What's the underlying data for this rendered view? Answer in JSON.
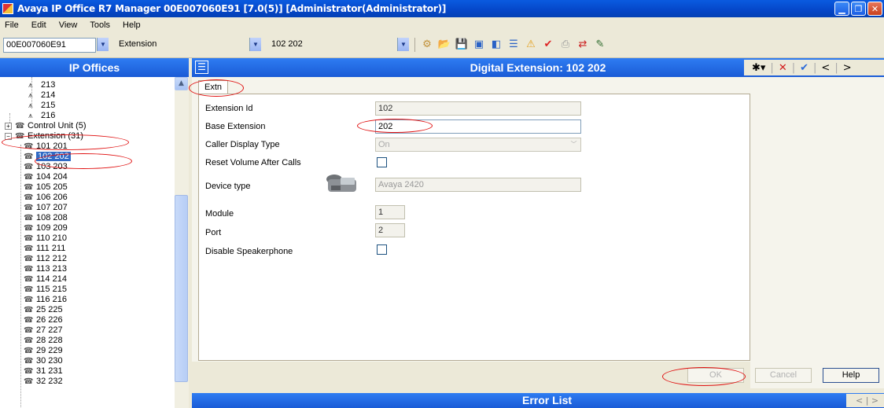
{
  "window": {
    "title": "Avaya IP Office R7 Manager 00E007060E91 [7.0(5)] [Administrator(Administrator)]"
  },
  "menu": [
    "File",
    "Edit",
    "View",
    "Tools",
    "Help"
  ],
  "toolbar": {
    "system_combo": "00E007060E91",
    "type_combo": "Extension",
    "item_combo": "102 202"
  },
  "left_panel": {
    "title": "IP Offices",
    "tree": [
      {
        "label": "213",
        "kind": "short"
      },
      {
        "label": "214",
        "kind": "short"
      },
      {
        "label": "215",
        "kind": "short"
      },
      {
        "label": "216",
        "kind": "short"
      },
      {
        "label": "Control Unit (5)",
        "kind": "group"
      },
      {
        "label": "Extension (31)",
        "kind": "group-open"
      },
      {
        "label": "101 201",
        "kind": "ext"
      },
      {
        "label": "102 202",
        "kind": "ext",
        "selected": true
      },
      {
        "label": "103 203",
        "kind": "ext"
      },
      {
        "label": "104 204",
        "kind": "ext"
      },
      {
        "label": "105 205",
        "kind": "ext"
      },
      {
        "label": "106 206",
        "kind": "ext"
      },
      {
        "label": "107 207",
        "kind": "ext"
      },
      {
        "label": "108 208",
        "kind": "ext"
      },
      {
        "label": "109 209",
        "kind": "ext"
      },
      {
        "label": "110 210",
        "kind": "ext"
      },
      {
        "label": "111 211",
        "kind": "ext"
      },
      {
        "label": "112 212",
        "kind": "ext"
      },
      {
        "label": "113 213",
        "kind": "ext"
      },
      {
        "label": "114 214",
        "kind": "ext"
      },
      {
        "label": "115 215",
        "kind": "ext"
      },
      {
        "label": "116 216",
        "kind": "ext"
      },
      {
        "label": "25 225",
        "kind": "ext"
      },
      {
        "label": "26 226",
        "kind": "ext"
      },
      {
        "label": "27 227",
        "kind": "ext"
      },
      {
        "label": "28 228",
        "kind": "ext"
      },
      {
        "label": "29 229",
        "kind": "ext"
      },
      {
        "label": "30 230",
        "kind": "ext"
      },
      {
        "label": "31 231",
        "kind": "ext"
      },
      {
        "label": "32 232",
        "kind": "ext"
      }
    ]
  },
  "detail": {
    "title": "Digital Extension: 102 202",
    "tab": "Extn",
    "fields": {
      "extension_id_label": "Extension Id",
      "extension_id_value": "102",
      "base_extension_label": "Base Extension",
      "base_extension_value": "202",
      "caller_display_label": "Caller Display Type",
      "caller_display_value": "On",
      "reset_volume_label": "Reset Volume After Calls",
      "device_type_label": "Device type",
      "device_type_value": "Avaya 2420",
      "module_label": "Module",
      "module_value": "1",
      "port_label": "Port",
      "port_value": "2",
      "disable_speaker_label": "Disable Speakerphone"
    },
    "buttons": {
      "ok": "OK",
      "cancel": "Cancel",
      "help": "Help"
    }
  },
  "error_list": {
    "title": "Error List"
  },
  "colors": {
    "header_blue": "#1a5bd6",
    "annotation_red": "#e01010"
  }
}
